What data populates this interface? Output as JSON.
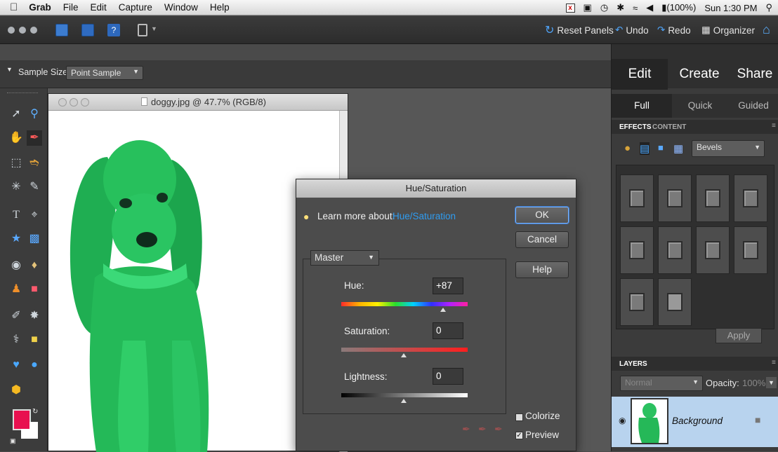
{
  "menubar": {
    "app": "Grab",
    "items": [
      "File",
      "Edit",
      "Capture",
      "Window",
      "Help"
    ],
    "battery": "(100%)",
    "clock": "Sun 1:30 PM"
  },
  "toolbar": {
    "reset_panels": "Reset Panels",
    "undo": "Undo",
    "redo": "Redo",
    "organizer": "Organizer"
  },
  "options": {
    "sample_size_label": "Sample Size:",
    "sample_size_value": "Point Sample"
  },
  "document": {
    "title": "doggy.jpg @ 47.7% (RGB/8)"
  },
  "dialog": {
    "title": "Hue/Saturation",
    "learn_more_label": "Learn more about:",
    "learn_more_link": "Hue/Saturation",
    "ok": "OK",
    "cancel": "Cancel",
    "help": "Help",
    "channel": "Master",
    "hue_label": "Hue:",
    "hue_value": "+87",
    "saturation_label": "Saturation:",
    "saturation_value": "0",
    "lightness_label": "Lightness:",
    "lightness_value": "0",
    "colorize_label": "Colorize",
    "colorize_checked": false,
    "preview_label": "Preview",
    "preview_checked": true
  },
  "panel": {
    "tabs": [
      "Edit",
      "Create",
      "Share"
    ],
    "subtabs": [
      "Full",
      "Quick",
      "Guided"
    ],
    "effects_tab": "EFFECTS",
    "content_tab": "CONTENT",
    "effects_category": "Bevels",
    "apply": "Apply",
    "layers_label": "LAYERS",
    "blend_mode": "Normal",
    "opacity_label": "Opacity:",
    "opacity_value": "100%",
    "layer_name": "Background"
  },
  "colors": {
    "foreground": "#e8104f",
    "background": "#ffffff",
    "dog_green": "#25c25d",
    "link_blue": "#2f9cf0"
  }
}
